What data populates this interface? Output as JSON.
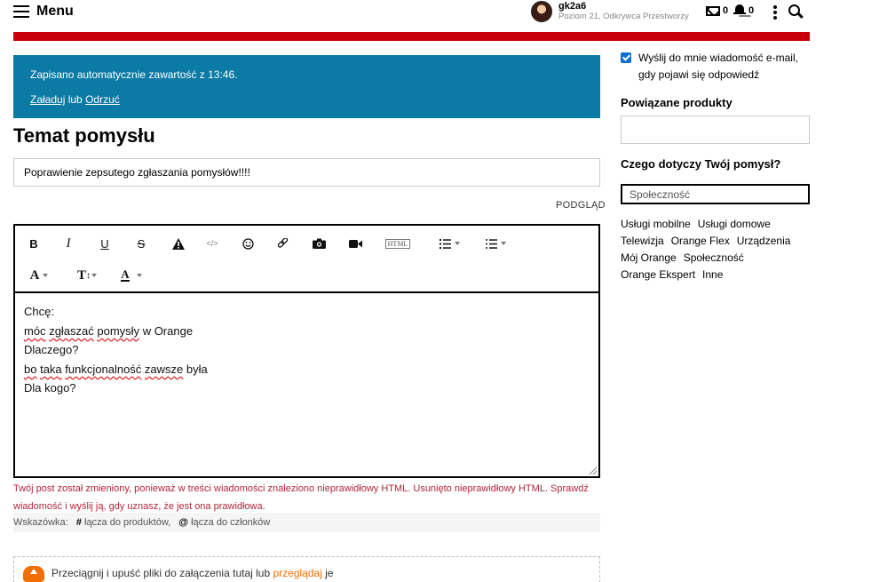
{
  "header": {
    "menu_label": "Menu",
    "user_name": "gk2a6",
    "user_rank": "Poziom 21, Odkrywca Przestworzy",
    "messages_count": "0",
    "notifications_count": "0",
    "brand_color": "#c8000c"
  },
  "autosave": {
    "message": "Zapisano automatycznie zawartość z 13:46.",
    "load_link": "Załaduj",
    "or_text": "lub",
    "discard_link": "Odrzuć"
  },
  "form": {
    "title": "Temat pomysłu",
    "subject_value": "Poprawienie zepsutego zgłaszania pomysłów!!!!",
    "preview_link": "PODGLĄD"
  },
  "editor": {
    "toolbar": [
      "bold-icon",
      "italic-icon",
      "underline-icon",
      "strikethrough-icon",
      "warning-icon",
      "code-icon",
      "emoji-icon",
      "link-icon",
      "camera-icon",
      "video-icon",
      "html-icon",
      "ordered-list-icon",
      "bullet-list-icon",
      "font-family-icon",
      "font-size-icon",
      "font-color-icon"
    ],
    "html_label": "HTML",
    "lines": [
      {
        "text": "Chcę:"
      },
      {
        "pre": "",
        "spell1": "móc",
        "mid": " ",
        "spell2": "zgłaszać",
        "mid2": " ",
        "spell3": "pomysły",
        "post": " w Orange"
      },
      {
        "text": "Dlaczego?"
      },
      {
        "pre": "",
        "spell1": "bo",
        "mid": " ",
        "spell2": "taka",
        "mid2": " ",
        "spell3": "funkcjonalność",
        "mid3": " ",
        "spell4": "zawsze",
        "post": " była"
      },
      {
        "text": "Dla kogo?"
      }
    ]
  },
  "error_message": "Twój post został zmieniony, ponieważ w treści wiadomości znaleziono nieprawidłowy HTML. Usunięto nieprawidłowy HTML. Sprawdź wiadomość i wyślij ją, gdy uznasz, że jest ona prawidłowa.",
  "hint": {
    "label": "Wskazówka:",
    "products_symbol": "#",
    "products_text": "łącza do produktów,",
    "members_symbol": "@",
    "members_text": "łącza do członków"
  },
  "dropzone": {
    "text": "Przeciągnij i upuść pliki do załączenia tutaj lub",
    "browse_link": "przeglądaj",
    "suffix": "je"
  },
  "sidebar": {
    "notify_label": "Wyślij do mnie wiadomość e-mail, gdy pojawi się odpowiedź",
    "notify_checked": true,
    "related_products_heading": "Powiązane produkty",
    "category_heading": "Czego dotyczy Twój pomysł?",
    "category_value": "Społeczność",
    "tags": [
      "Usługi mobilne",
      "Usługi domowe",
      "Telewizja",
      "Orange Flex",
      "Urządzenia",
      "Mój Orange",
      "Społeczność",
      "Orange Ekspert",
      "Inne"
    ]
  }
}
